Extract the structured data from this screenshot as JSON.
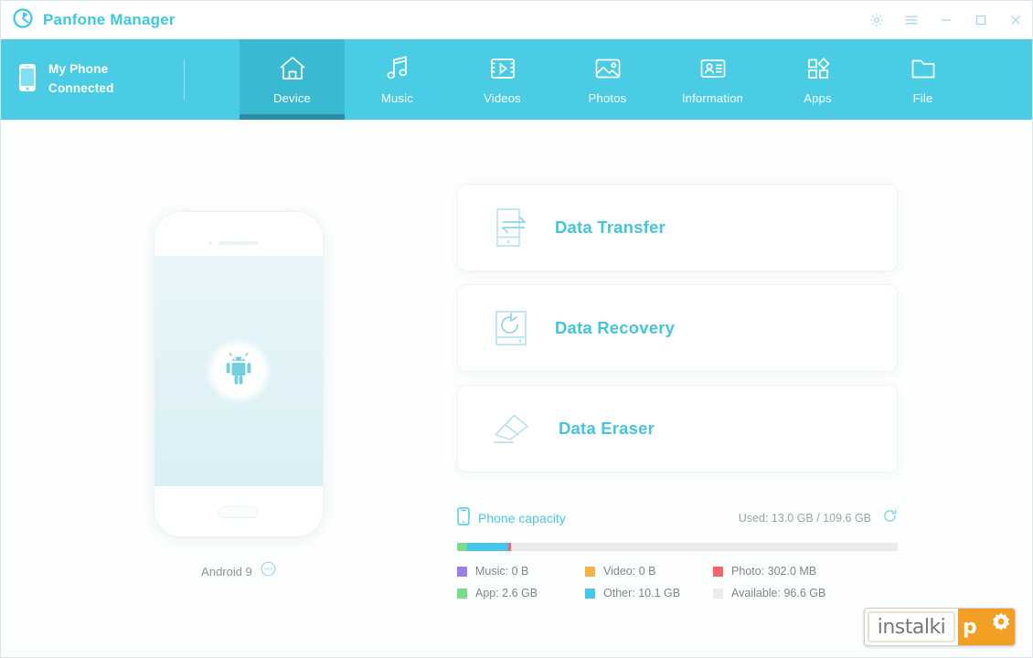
{
  "window": {
    "title": "Panfone Manager",
    "logo_icon": "panfone-logo-icon",
    "controls": [
      {
        "name": "settings-button",
        "icon": "gear-icon"
      },
      {
        "name": "menu-button",
        "icon": "hamburger-icon"
      },
      {
        "name": "minimize-button",
        "icon": "minimize-icon"
      },
      {
        "name": "maximize-button",
        "icon": "maximize-icon"
      },
      {
        "name": "close-button",
        "icon": "close-icon"
      }
    ]
  },
  "navbar": {
    "accent_color": "#49cce4",
    "active_tab_color": "#3ab9d2",
    "device": {
      "icon": "phone-icon",
      "name": "My Phone",
      "status": "Connected"
    },
    "tabs": [
      {
        "label": "Device",
        "icon": "home-icon",
        "active": true
      },
      {
        "label": "Music",
        "icon": "music-note-icon",
        "active": false
      },
      {
        "label": "Videos",
        "icon": "film-play-icon",
        "active": false
      },
      {
        "label": "Photos",
        "icon": "picture-icon",
        "active": false
      },
      {
        "label": "Information",
        "icon": "contact-card-icon",
        "active": false
      },
      {
        "label": "Apps",
        "icon": "apps-grid-icon",
        "active": false
      },
      {
        "label": "File",
        "icon": "folder-icon",
        "active": false
      }
    ]
  },
  "device_panel": {
    "screen_icon": "android-robot-icon",
    "os_label": "Android 9",
    "os_more_icon": "more-info-icon"
  },
  "cards": [
    {
      "label": "Data Transfer",
      "icon": "data-transfer-icon"
    },
    {
      "label": "Data Recovery",
      "icon": "data-recovery-icon"
    },
    {
      "label": "Data Eraser",
      "icon": "data-eraser-icon"
    }
  ],
  "capacity": {
    "icon": "phone-capacity-icon",
    "title": "Phone capacity",
    "used_text": "Used: 13.0 GB / 109.6 GB",
    "refresh_icon": "refresh-icon",
    "total_gb": 109.6,
    "used_gb": 13.0,
    "segments": [
      {
        "label": "Music",
        "value": "0 B",
        "gb": 0,
        "color": "#9b7ee8"
      },
      {
        "label": "App",
        "value": "2.6 GB",
        "gb": 2.6,
        "color": "#76dd8c"
      },
      {
        "label": "Video",
        "value": "0 B",
        "gb": 0,
        "color": "#f2b544"
      },
      {
        "label": "Other",
        "value": "10.1 GB",
        "gb": 10.1,
        "color": "#44c8ea"
      },
      {
        "label": "Photo",
        "value": "302.0 MB",
        "gb": 0.3,
        "color": "#f4636e"
      },
      {
        "label": "Available",
        "value": "96.6 GB",
        "gb": 96.6,
        "color": "#ebebeb"
      }
    ],
    "legend_order": [
      "Music",
      "Video",
      "Photo",
      "App",
      "Other",
      "Available"
    ]
  },
  "watermark": {
    "left_text": "instalki",
    "right_text": "p",
    "gear_icon": "gear-icon",
    "accent": "#f2a024"
  }
}
